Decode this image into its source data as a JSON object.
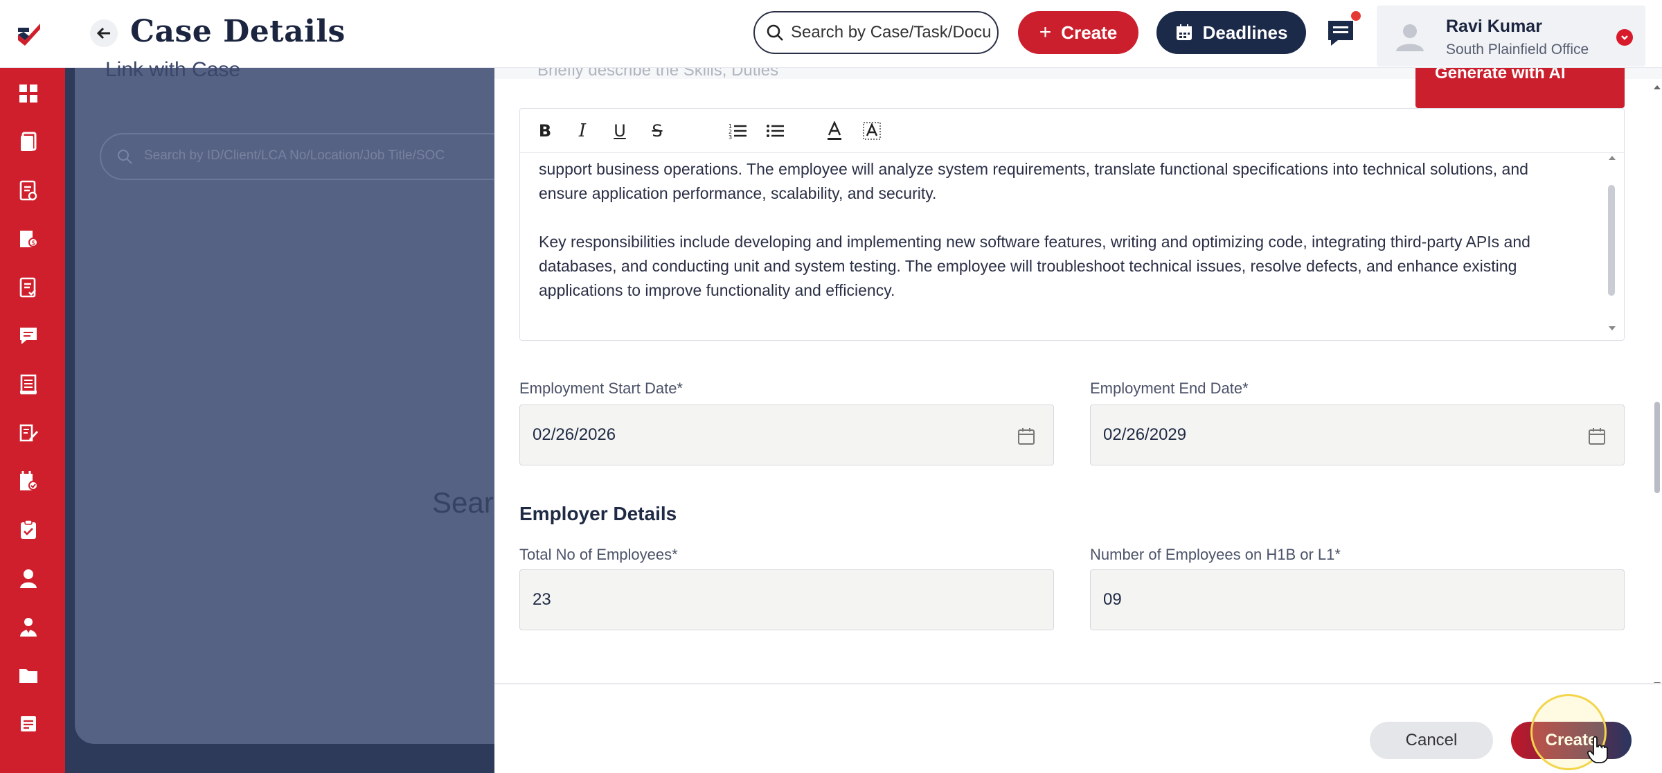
{
  "header": {
    "title": "Case Details",
    "search_placeholder": "Search by Case/Task/Docu",
    "create_label": "Create",
    "deadlines_label": "Deadlines",
    "user": {
      "name": "Ravi Kumar",
      "office": "South Plainfield Office"
    }
  },
  "sidebar": {
    "icons": [
      "dashboard-icon",
      "cases-icon",
      "tasks-icon",
      "invoices-icon",
      "forms-icon",
      "messages-icon",
      "documents-icon",
      "notes-icon",
      "checklist-icon",
      "clipboard-icon",
      "users-icon",
      "contacts-icon",
      "folder-icon",
      "reports-icon"
    ]
  },
  "background": {
    "panel_label": "Link with Case",
    "search_placeholder": "Search by ID/Client/LCA No/Location/Job Title/SOC",
    "big_text": "Sear"
  },
  "drawer": {
    "duties_placeholder": "Briefly describe the Skills, Duties",
    "generate_ai_label": "Generate with AI",
    "editor_paragraphs": [
      "support business operations. The employee will analyze system requirements, translate functional specifications into technical solutions, and ensure application performance, scalability, and security.",
      "Key responsibilities include developing and implementing new software features, writing and optimizing code, integrating third-party APIs and databases, and conducting unit and system testing. The employee will troubleshoot technical issues, resolve defects, and enhance existing applications to improve functionality and efficiency."
    ],
    "start_date": {
      "label": "Employment Start Date*",
      "value": "02/26/2026"
    },
    "end_date": {
      "label": "Employment End Date*",
      "value": "02/26/2029"
    },
    "employer_section_title": "Employer Details",
    "total_employees": {
      "label": "Total No of Employees*",
      "value": "23"
    },
    "h1b_employees": {
      "label": "Number of Employees on H1B or L1*",
      "value": "09"
    },
    "footer": {
      "cancel_label": "Cancel",
      "create_label": "Create"
    }
  },
  "colors": {
    "brand_red": "#cc1f2d",
    "navy": "#1c2a4a"
  }
}
